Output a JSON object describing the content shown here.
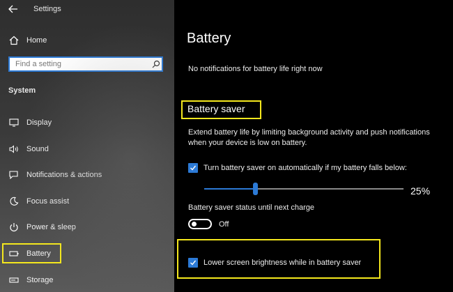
{
  "window": {
    "title": "Settings"
  },
  "sidebar": {
    "home_label": "Home",
    "search_placeholder": "Find a setting",
    "section_label": "System",
    "items": [
      {
        "label": "Display",
        "icon": "display-icon"
      },
      {
        "label": "Sound",
        "icon": "sound-icon"
      },
      {
        "label": "Notifications & actions",
        "icon": "notifications-icon"
      },
      {
        "label": "Focus assist",
        "icon": "moon-icon"
      },
      {
        "label": "Power & sleep",
        "icon": "power-icon"
      },
      {
        "label": "Battery",
        "icon": "battery-icon",
        "selected": true
      },
      {
        "label": "Storage",
        "icon": "storage-icon"
      }
    ]
  },
  "main": {
    "title": "Battery",
    "status_text": "No notifications for battery life right now",
    "battery_saver": {
      "heading": "Battery saver",
      "description": "Extend battery life by limiting background activity and push notifications when your device is low on battery.",
      "auto_checkbox_label": "Turn battery saver on automatically if my battery falls below:",
      "auto_checked": true,
      "threshold_value": "25%",
      "threshold_fraction": 0.25,
      "status_label": "Battery saver status until next charge",
      "toggle_state": "Off",
      "brightness_checkbox_label": "Lower screen brightness while in battery saver",
      "brightness_checked": true
    }
  },
  "colors": {
    "accent": "#2c7ad6",
    "highlight": "#f5e81d",
    "background": "#000000"
  }
}
